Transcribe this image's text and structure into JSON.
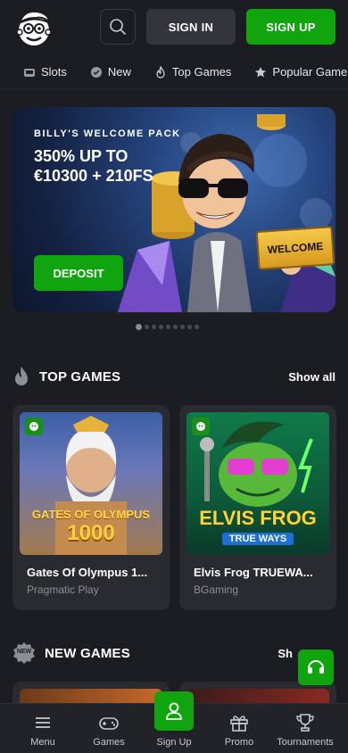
{
  "header": {
    "signin_label": "SIGN IN",
    "signup_label": "SIGN UP"
  },
  "categories": [
    {
      "icon": "slot-machine-icon",
      "label": "Slots"
    },
    {
      "icon": "new-badge-icon",
      "label": "New"
    },
    {
      "icon": "flame-icon",
      "label": "Top Games"
    },
    {
      "icon": "star-icon",
      "label": "Popular Game"
    }
  ],
  "banner": {
    "kicker": "BILLY'S WELCOME PACK",
    "headline_line1": "350% UP TO",
    "headline_line2": "€10300 + 210FS",
    "deposit_label": "DEPOSIT",
    "sign_text": "WELCOME"
  },
  "carousel": {
    "total": 9,
    "active": 0
  },
  "top_games": {
    "title": "TOP GAMES",
    "show_all": "Show all",
    "games": [
      {
        "name": "Gates Of Olympus 1...",
        "provider": "Pragmatic Play",
        "logo_line1": "GATES OF OLYMPUS",
        "logo_line2": "1000"
      },
      {
        "name": "Elvis Frog TRUEWA...",
        "provider": "BGaming",
        "logo_line1": "ELVIS FROG",
        "logo_line2": "TRUE WAYS"
      }
    ]
  },
  "new_games": {
    "badge": "NEW",
    "title": "NEW GAMES",
    "show_all": "Sh"
  },
  "bottom_nav": [
    {
      "icon": "menu-icon",
      "label": "Menu"
    },
    {
      "icon": "gamepad-icon",
      "label": "Games"
    },
    {
      "icon": "user-icon",
      "label": "Sign Up"
    },
    {
      "icon": "gift-icon",
      "label": "Promo"
    },
    {
      "icon": "trophy-icon",
      "label": "Tournaments"
    }
  ],
  "colors": {
    "accent": "#10a50f",
    "background": "#1c1d22",
    "card": "#2a2b31"
  }
}
